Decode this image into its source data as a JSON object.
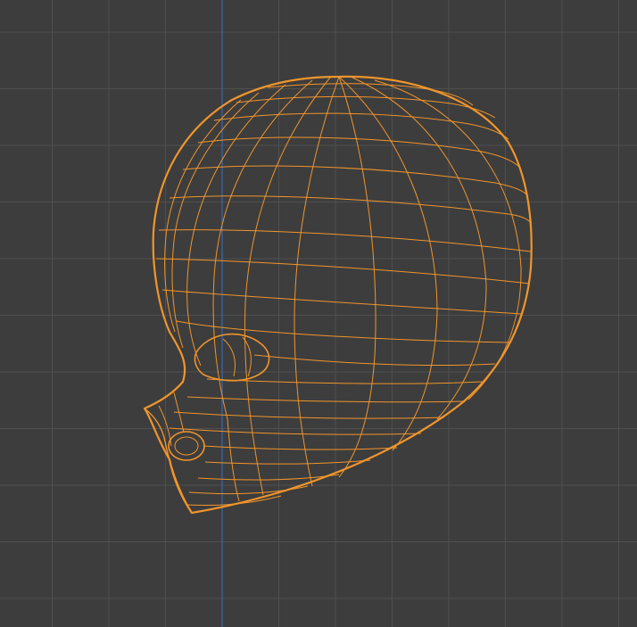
{
  "viewport": {
    "view": "side-orthographic-wireframe",
    "background_color": "#3d3d3d",
    "grid_color": "#4f4f4f",
    "axis_color": "#3a67b5",
    "wire_color": "#f0952c",
    "object": "head-mesh"
  }
}
